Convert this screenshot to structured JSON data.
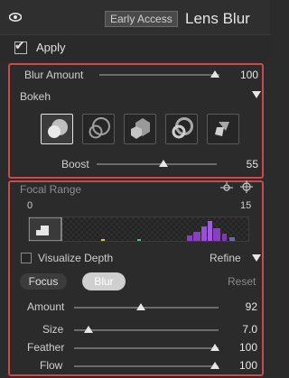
{
  "header": {
    "badge": "Early Access",
    "title": "Lens Blur"
  },
  "apply": {
    "label": "Apply",
    "checked": true
  },
  "blur_amount": {
    "label": "Blur Amount",
    "value": "100",
    "fraction": 1.0
  },
  "bokeh": {
    "label": "Bokeh",
    "shapes": [
      "bokeh-shape-1-icon",
      "bokeh-shape-2-icon",
      "bokeh-shape-3-icon",
      "bokeh-shape-4-icon",
      "bokeh-shape-5-icon"
    ],
    "selected_index": 0,
    "boost": {
      "label": "Boost",
      "value": "55",
      "fraction": 0.55
    }
  },
  "focal_range": {
    "label": "Focal Range",
    "min": "0",
    "max": "15"
  },
  "visualize_depth": {
    "label": "Visualize Depth",
    "checked": false
  },
  "refine": {
    "label": "Refine"
  },
  "focus_blur": {
    "focus_label": "Focus",
    "blur_label": "Blur",
    "reset_label": "Reset"
  },
  "sliders": [
    {
      "label": "Amount",
      "value": "92",
      "fraction": 0.46
    },
    {
      "label": "Size",
      "value": "7.0",
      "fraction": 0.05
    },
    {
      "label": "Feather",
      "value": "100",
      "fraction": 1.0
    },
    {
      "label": "Flow",
      "value": "100",
      "fraction": 1.0
    }
  ],
  "colors": {
    "highlight": "#cc4a4a",
    "histogram_purple": "#8a3fc2"
  }
}
